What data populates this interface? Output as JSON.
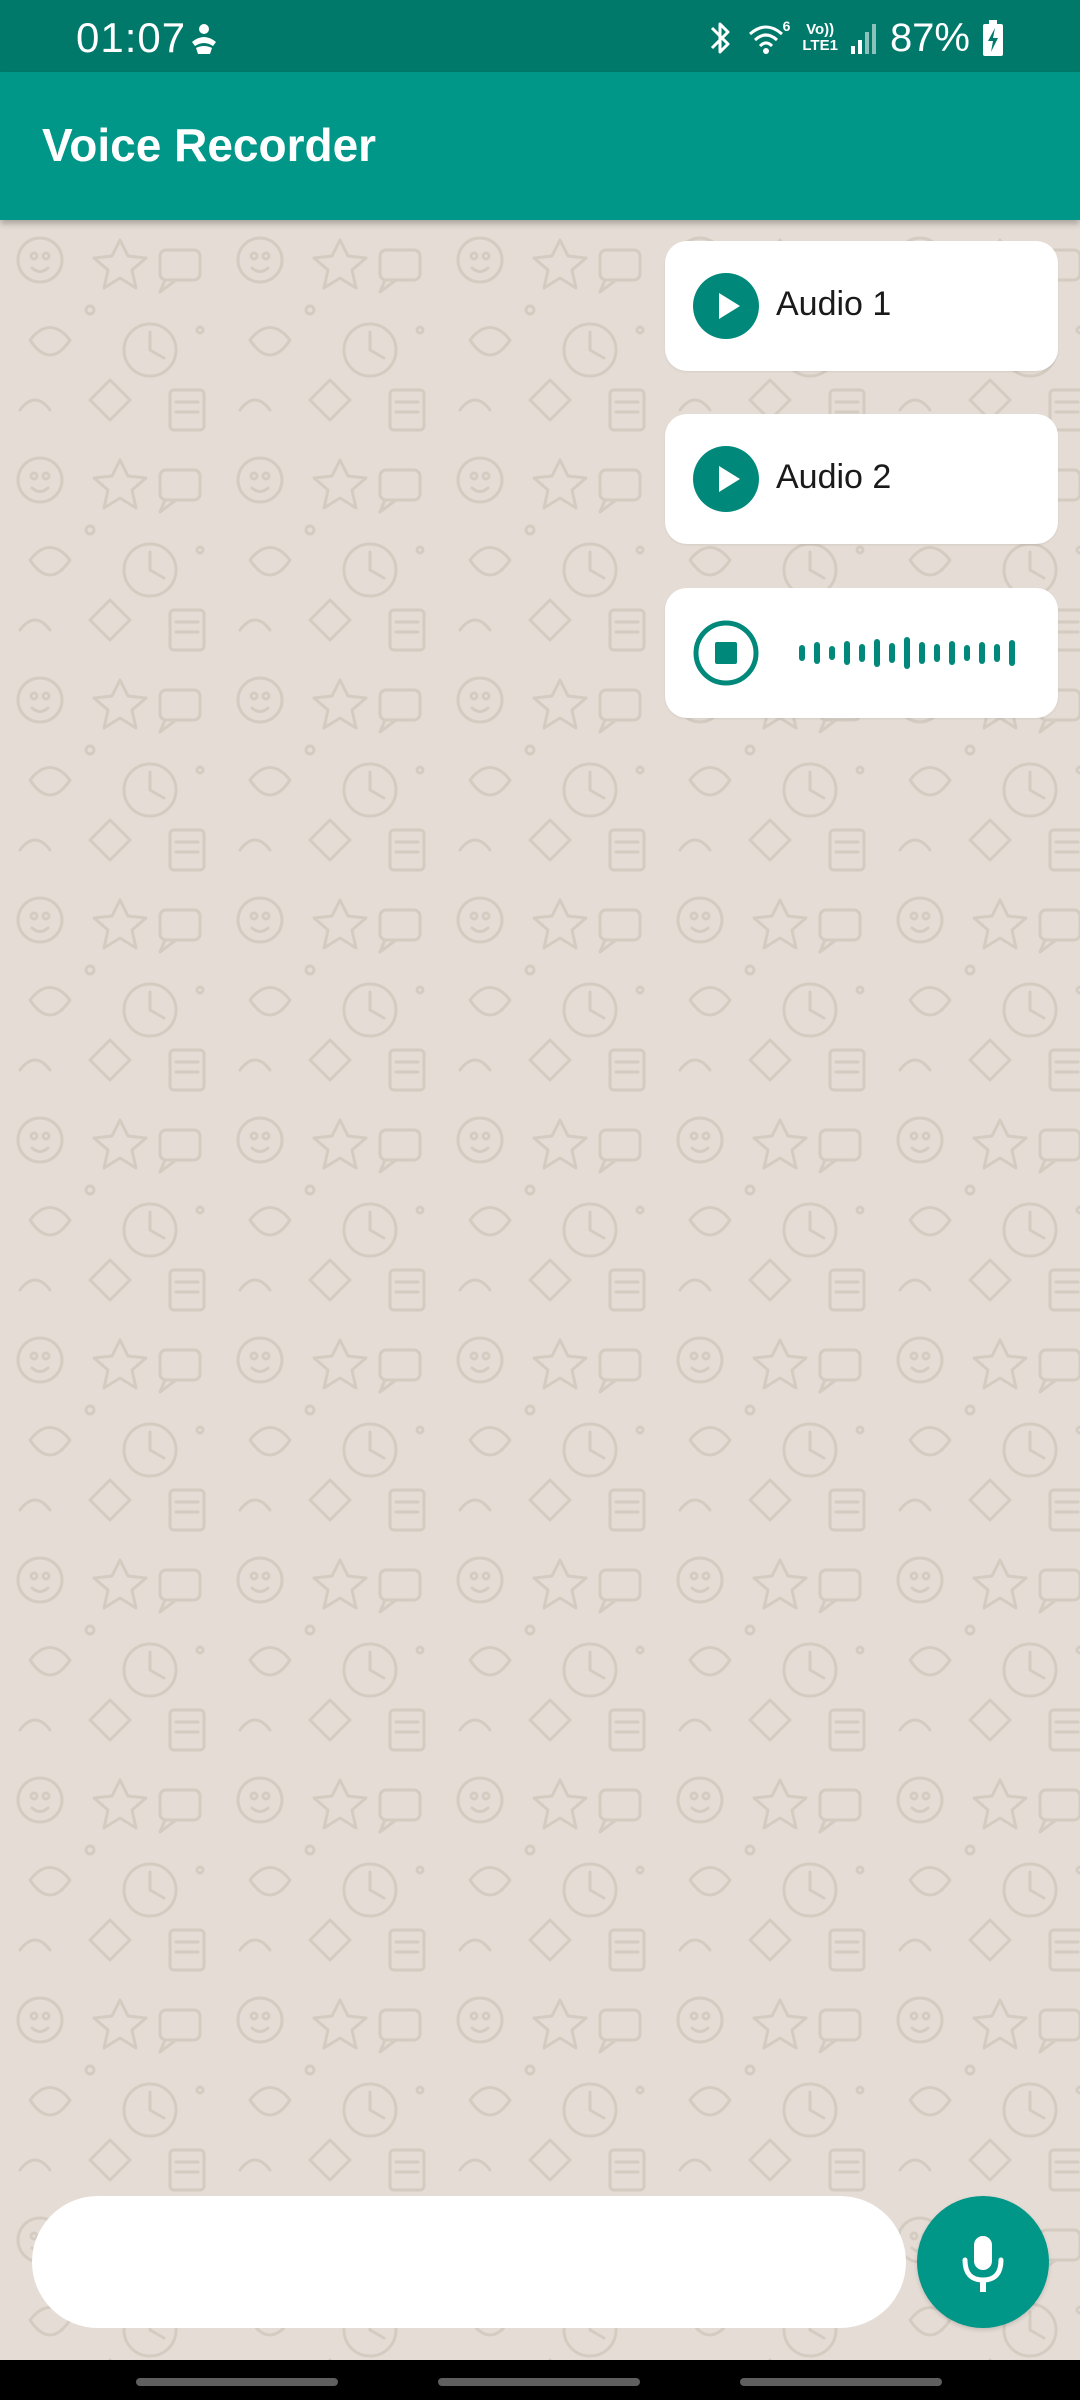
{
  "status_bar": {
    "time": "01:07",
    "battery": "87%",
    "icons": [
      "app-notification-icon",
      "bluetooth-icon",
      "wifi-icon",
      "volte-icon",
      "signal-icon",
      "battery-charging-icon"
    ],
    "wifi_badge": "6",
    "volte_label_top": "Vo))",
    "volte_label_bottom": "LTE1"
  },
  "app_bar": {
    "title": "Voice Recorder"
  },
  "messages": [
    {
      "label": "Audio 1",
      "icon": "play-icon"
    },
    {
      "label": "Audio 2",
      "icon": "play-icon"
    },
    {
      "icon": "stop-icon",
      "state": "recording",
      "waveform_icon": "waveform-icon"
    }
  ],
  "composer": {
    "input_value": "",
    "input_placeholder": "",
    "mic_icon": "mic-icon"
  },
  "colors": {
    "status_bar": "#00796b",
    "app_bar": "#009688",
    "accent": "#00897b",
    "background": "#e5ddd5",
    "bubble": "#ffffff"
  }
}
